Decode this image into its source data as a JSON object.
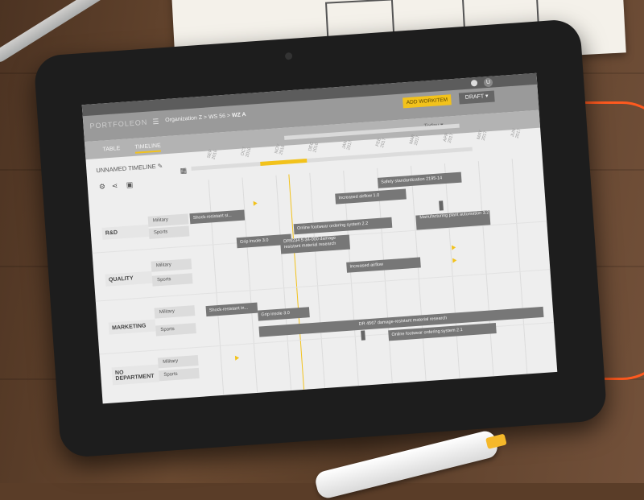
{
  "app": {
    "logo": "PORTFOLEON"
  },
  "header": {
    "breadcrumb_org": "Organization Z",
    "breadcrumb_ws": "WS  56",
    "breadcrumb_wz": "WZ  A",
    "add_button": "ADD WORKITEM",
    "draft_label": "DRAFT ▾",
    "user_initial": "U",
    "today_label": "Today  ▾"
  },
  "tabs": [
    {
      "label": "TABLE"
    },
    {
      "label": "TIMELINE"
    }
  ],
  "timeline": {
    "name": "UNNAMED TIMELINE ✎"
  },
  "months": [
    "SEP\n2016",
    "OCT\n2016",
    "NOV\n2016",
    "DEC\n2016",
    "JAN\n2017",
    "FEB\n2017",
    "MAR\n2017",
    "APR\n2017",
    "MAY\n2017",
    "JUN\n2017"
  ],
  "departments": [
    {
      "name": "R&D",
      "subs": [
        "Military",
        "Sports"
      ]
    },
    {
      "name": "QUALITY",
      "subs": [
        "Military",
        "Sports"
      ]
    },
    {
      "name": "MARKETING",
      "subs": [
        "Military",
        "Sports"
      ]
    },
    {
      "name": "NO DEPARTMENT",
      "subs": [
        "Military",
        "Sports"
      ]
    }
  ],
  "workitems": [
    {
      "label": "Safety standardization 2195-14"
    },
    {
      "label": "Increased airflow 1.0"
    },
    {
      "label": "Shock-resistant si..."
    },
    {
      "label": "Online footwear ordering system 2.2"
    },
    {
      "label": "Manufacturing plant automation 3.2"
    },
    {
      "label": "Grip insole 3.0"
    },
    {
      "label": "DR9234 5-34-000  damage resistant material  research"
    },
    {
      "label": "Increased airflow"
    },
    {
      "label": "Shock-resistant in..."
    },
    {
      "label": "Grip insole 3.0"
    },
    {
      "label": "DR 4567 damage-resistant material research"
    },
    {
      "label": "Online footwear ordering system 2.1"
    }
  ],
  "colors": {
    "accent": "#f2c21b",
    "bar": "#777777",
    "header": "#9a9a9a"
  }
}
